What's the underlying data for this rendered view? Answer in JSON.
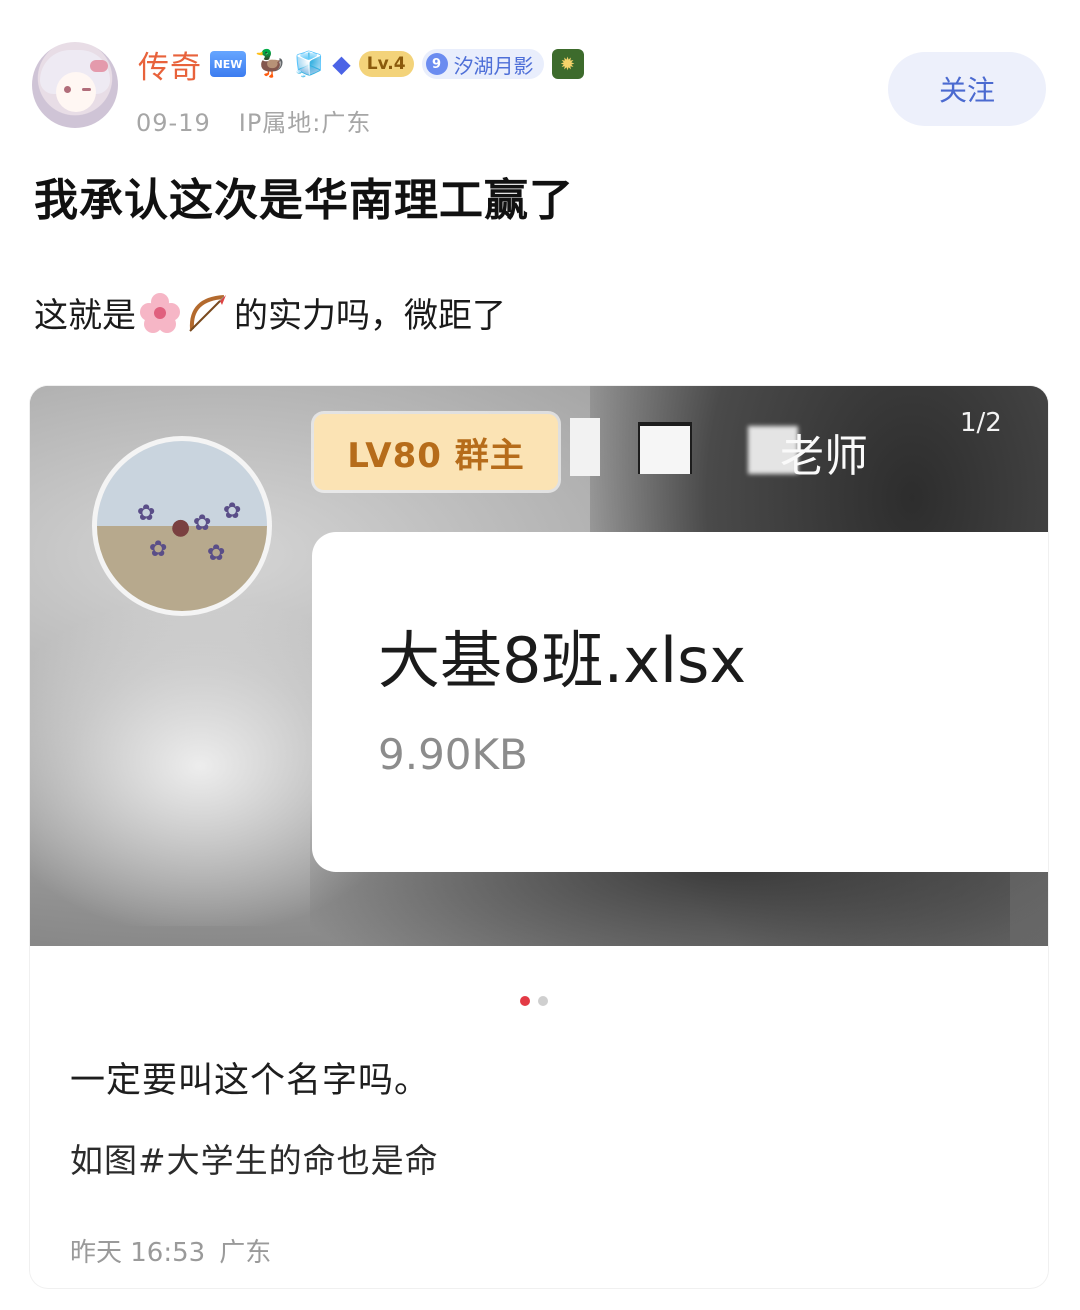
{
  "user": {
    "name": "传奇",
    "badges": {
      "new": "NEW",
      "duck_icon": "duck-badge-icon",
      "cube_icon": "ice-cube-badge-icon",
      "gem_icon": "blue-gem-badge-icon",
      "level": "Lv.4",
      "group_number": "9",
      "group_name": "汐湖月影",
      "shield_icon": "green-shield-badge-icon"
    },
    "date": "09-19",
    "ip_location": "IP属地:广东"
  },
  "follow_button": {
    "label": "关注"
  },
  "post": {
    "title": "我承认这次是华南理工赢了",
    "body_prefix": "这就是",
    "body_emojis": [
      "cherry-blossom-icon",
      "bow-and-arrow-icon"
    ],
    "body_suffix": "的实力吗，微距了"
  },
  "media": {
    "level_tag": "LV80 群主",
    "teacher_text": "老师",
    "page_counter": "1/2",
    "file_name": "大基8班.xlsx",
    "file_size": "9.90KB",
    "carousel": {
      "count": 2,
      "active": 1
    }
  },
  "card": {
    "caption": "一定要叫这个名字吗。",
    "tagline": "如图#大学生的命也是命",
    "time": "昨天 16:53",
    "location": "广东"
  },
  "colors": {
    "username": "#e8623b",
    "follow_bg": "#edf0fb",
    "follow_text": "#4b6ad0",
    "level_tag_bg": "#fbe3b4",
    "active_dot": "#e33a45"
  }
}
